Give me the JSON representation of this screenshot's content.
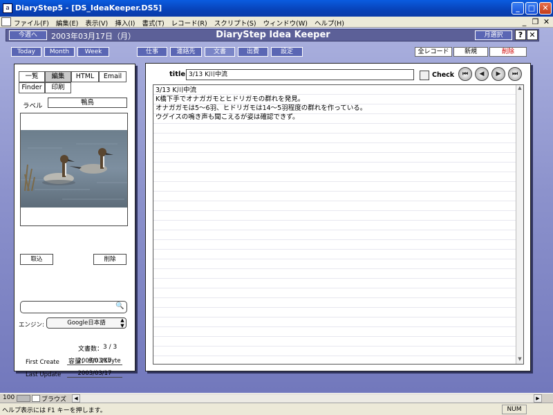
{
  "window": {
    "app_icon": "a",
    "title": "DiaryStep5 - [DS_IdeaKeeper.DS5]",
    "minimize": "_",
    "maximize": "□",
    "close": "✕"
  },
  "menubar": {
    "items": [
      "ファイル(F)",
      "編集(E)",
      "表示(V)",
      "挿入(I)",
      "書式(T)",
      "レコード(R)",
      "スクリプト(S)",
      "ウィンドウ(W)",
      "ヘルプ(H)"
    ],
    "mdi_min": "_",
    "mdi_restore": "❐",
    "mdi_close": "✕"
  },
  "header": {
    "this_week": "今週へ",
    "date": "2003年03月17日（月）",
    "app_title": "DiaryStep Idea Keeper",
    "month_select": "月選択",
    "help": "?",
    "close": "✕"
  },
  "nav": {
    "today": "Today",
    "month": "Month",
    "week": "Week",
    "categories": [
      "仕事",
      "連絡先",
      "文書",
      "出費",
      "設定"
    ],
    "all_records": "全レコード",
    "new": "新規",
    "delete": "削除"
  },
  "left": {
    "tabs_row1": [
      "一覧",
      "編集",
      "HTML",
      "Email"
    ],
    "tabs_row2": [
      "Finder",
      "印刷"
    ],
    "label_caption": "ラベル",
    "label_value": "鴨鳥",
    "import_btn": "取込",
    "delete_btn": "削除",
    "search_value": "",
    "search_icon": "🔍",
    "engine_caption": "エンジン:",
    "engine_value": "Google日本語",
    "doc_count_label": "文書数：",
    "doc_count": "3 / 3",
    "first_create_label": "First Create",
    "first_create": "2003/03/17",
    "last_update_label": "Last Update",
    "last_update": "2003/03/17",
    "size_label": "容量：",
    "size_value": "約0.2Kbyte"
  },
  "right": {
    "title_label": "title",
    "title_value": "3/13 K川中流",
    "check_label": "Check",
    "nav_first": "⏮",
    "nav_prev": "◀",
    "nav_next": "▶",
    "nav_last": "⏭",
    "body_lines": [
      "3/13 K川中流",
      "K橋下手でオナガガモとヒドリガモの群れを発見。",
      "オナガガモは5～6羽、ヒドリガモは14～5羽程度の群れを作っている。",
      "ウグイスの鳴き声も聞こえるが姿は確認できず。"
    ]
  },
  "bottom": {
    "zoom": "100",
    "mode": "ブラウズ",
    "status_text": "ヘルプ表示には F1 キーを押します。",
    "num": "NUM"
  },
  "colors": {
    "nav_blue": "#5a66b4",
    "header_bar": "#5c6098",
    "delete_red": "#cc0000"
  }
}
